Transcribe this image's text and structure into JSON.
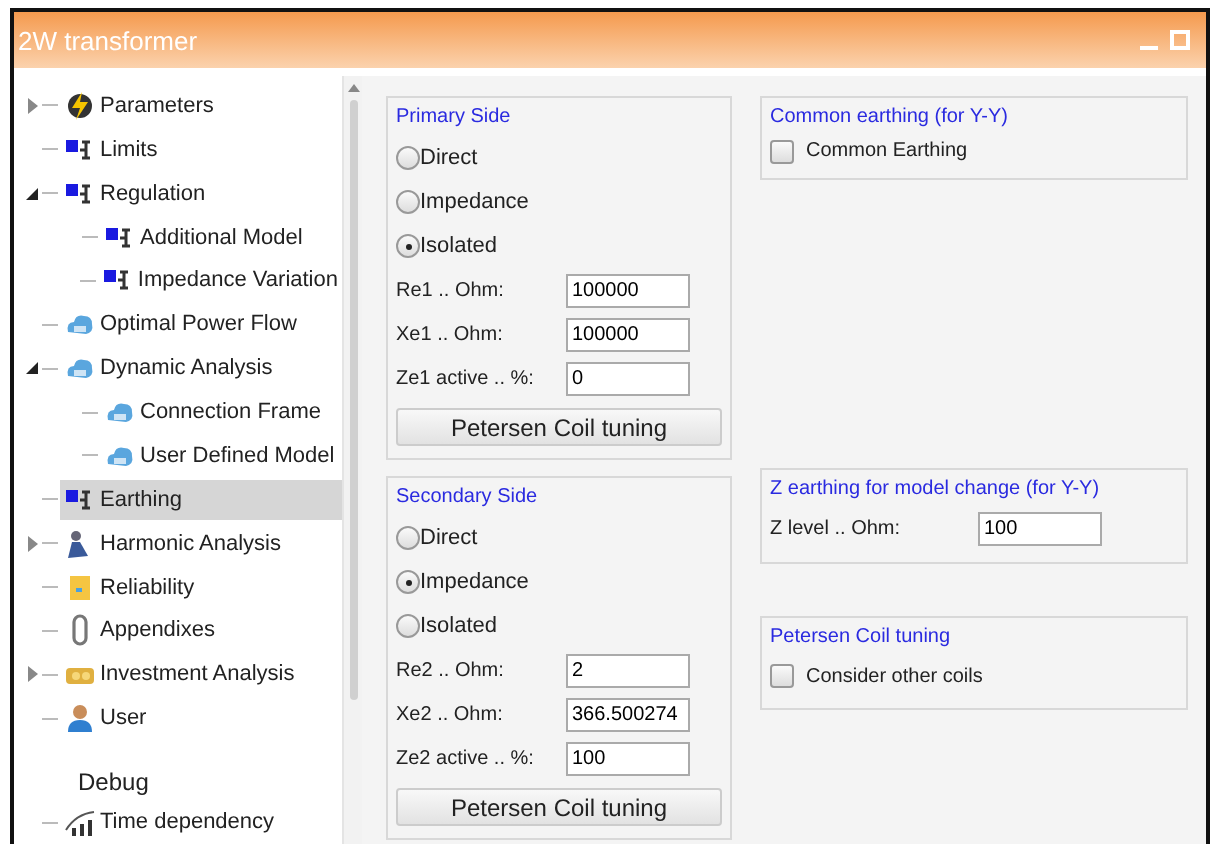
{
  "window": {
    "title": "2W transformer"
  },
  "tree": [
    {
      "label": "Parameters",
      "kind": "bolt",
      "has_children": true,
      "expanded": false,
      "selected": false
    },
    {
      "label": "Limits",
      "kind": "node",
      "has_children": false,
      "expanded": false,
      "selected": false
    },
    {
      "label": "Regulation",
      "kind": "node",
      "has_children": true,
      "expanded": true,
      "selected": false,
      "children": [
        {
          "label": "Additional Model",
          "kind": "node",
          "has_children": false,
          "expanded": false,
          "selected": false
        },
        {
          "label": "Impedance Variation",
          "kind": "node",
          "has_children": false,
          "expanded": false,
          "selected": false
        }
      ]
    },
    {
      "label": "Optimal Power Flow",
      "kind": "cloud",
      "has_children": false,
      "expanded": false,
      "selected": false
    },
    {
      "label": "Dynamic Analysis",
      "kind": "cloud",
      "has_children": true,
      "expanded": true,
      "selected": false,
      "children": [
        {
          "label": "Connection Frame",
          "kind": "cloud",
          "has_children": false,
          "expanded": false,
          "selected": false
        },
        {
          "label": "User Defined Model",
          "kind": "cloud",
          "has_children": false,
          "expanded": false,
          "selected": false
        }
      ]
    },
    {
      "label": "Earthing",
      "kind": "node",
      "has_children": false,
      "expanded": false,
      "selected": true
    },
    {
      "label": "Harmonic Analysis",
      "kind": "figure",
      "has_children": true,
      "expanded": false,
      "selected": false
    },
    {
      "label": "Reliability",
      "kind": "note",
      "has_children": false,
      "expanded": false,
      "selected": false
    },
    {
      "label": "Appendixes",
      "kind": "clip",
      "has_children": false,
      "expanded": false,
      "selected": false
    },
    {
      "label": "Investment Analysis",
      "kind": "coins",
      "has_children": true,
      "expanded": false,
      "selected": false
    },
    {
      "label": "User",
      "kind": "user",
      "has_children": false,
      "expanded": false,
      "selected": false
    }
  ],
  "debug": {
    "heading": "Debug",
    "items": [
      {
        "label": "Time dependency",
        "kind": "bars",
        "has_children": false,
        "expanded": false,
        "selected": false
      }
    ]
  },
  "sides": [
    {
      "title": "Primary Side",
      "options": [
        {
          "label": "Direct",
          "selected": false
        },
        {
          "label": "Impedance",
          "selected": false
        },
        {
          "label": "Isolated",
          "selected": true
        }
      ],
      "fields": [
        {
          "label": "Re1 .. Ohm:",
          "value": "100000"
        },
        {
          "label": "Xe1 .. Ohm:",
          "value": "100000"
        },
        {
          "label": "Ze1 active .. %:",
          "value": "0"
        }
      ],
      "button": "Petersen Coil tuning"
    },
    {
      "title": "Secondary Side",
      "options": [
        {
          "label": "Direct",
          "selected": false
        },
        {
          "label": "Impedance",
          "selected": true
        },
        {
          "label": "Isolated",
          "selected": false
        }
      ],
      "fields": [
        {
          "label": "Re2 .. Ohm:",
          "value": "2"
        },
        {
          "label": "Xe2 .. Ohm:",
          "value": "366.500274"
        },
        {
          "label": "Ze2 active .. %:",
          "value": "100"
        }
      ],
      "button": "Petersen Coil tuning"
    }
  ],
  "common_earthing": {
    "title": "Common earthing (for Y-Y)",
    "checkbox": {
      "label": "Common Earthing",
      "checked": false
    }
  },
  "z_earthing": {
    "title": "Z earthing for model change (for Y-Y)",
    "field": {
      "label": "Z level .. Ohm:",
      "value": "100"
    }
  },
  "petersen": {
    "title": "Petersen Coil tuning",
    "checkbox": {
      "label": "Consider other coils",
      "checked": false
    }
  }
}
